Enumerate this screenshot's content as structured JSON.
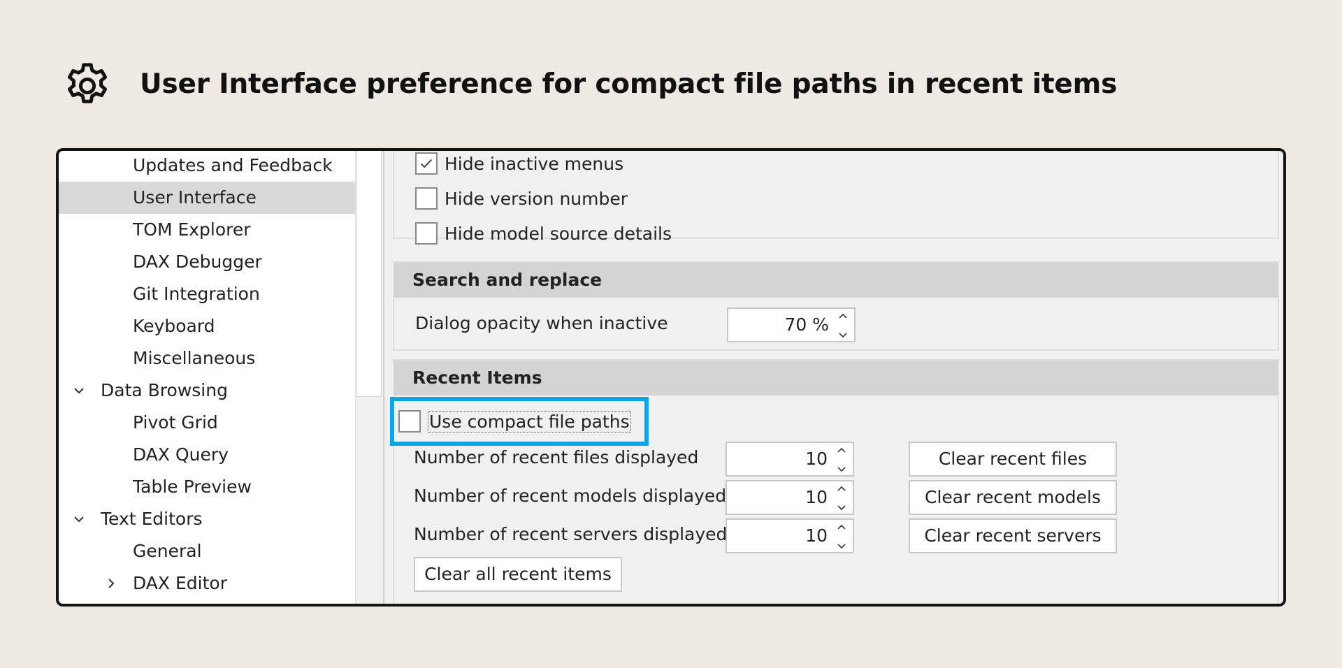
{
  "header": {
    "title": "User Interface preference for compact file paths in recent items",
    "icon": "gear-icon"
  },
  "tree": {
    "items": [
      {
        "label": "Updates and Feedback",
        "indent": 2,
        "selected": false
      },
      {
        "label": "User Interface",
        "indent": 2,
        "selected": true
      },
      {
        "label": "TOM Explorer",
        "indent": 2,
        "selected": false
      },
      {
        "label": "DAX Debugger",
        "indent": 2,
        "selected": false
      },
      {
        "label": "Git Integration",
        "indent": 2,
        "selected": false
      },
      {
        "label": "Keyboard",
        "indent": 2,
        "selected": false
      },
      {
        "label": "Miscellaneous",
        "indent": 2,
        "selected": false
      },
      {
        "label": "Data Browsing",
        "indent": 1,
        "selected": false,
        "expander": "expanded"
      },
      {
        "label": "Pivot Grid",
        "indent": 2,
        "selected": false
      },
      {
        "label": "DAX Query",
        "indent": 2,
        "selected": false
      },
      {
        "label": "Table Preview",
        "indent": 2,
        "selected": false
      },
      {
        "label": "Text Editors",
        "indent": 1,
        "selected": false,
        "expander": "expanded"
      },
      {
        "label": "General",
        "indent": 2,
        "selected": false
      },
      {
        "label": "DAX Editor",
        "indent": 2,
        "selected": false,
        "expander": "collapsed"
      }
    ]
  },
  "ui_group": {
    "hide_inactive_menus": {
      "label": "Hide inactive menus",
      "checked": true
    },
    "hide_version_number": {
      "label": "Hide version number",
      "checked": false
    },
    "hide_model_source_details": {
      "label": "Hide model source details",
      "checked": false
    }
  },
  "search_replace": {
    "header": "Search and replace",
    "opacity_label": "Dialog opacity when inactive",
    "opacity_value": "70 %"
  },
  "recent_items": {
    "header": "Recent Items",
    "compact_paths": {
      "label": "Use compact file paths",
      "checked": false
    },
    "files": {
      "label": "Number of recent files displayed",
      "value": "10",
      "button": "Clear recent files"
    },
    "models": {
      "label": "Number of recent models displayed",
      "value": "10",
      "button": "Clear recent models"
    },
    "servers": {
      "label": "Number of recent servers displayed",
      "value": "10",
      "button": "Clear recent servers"
    },
    "clear_all": "Clear all recent items"
  },
  "colors": {
    "background": "#eeeae3",
    "highlight": "#0aa6e6",
    "selected_row": "#d9d9d9",
    "group_header": "#d4d4d4"
  }
}
